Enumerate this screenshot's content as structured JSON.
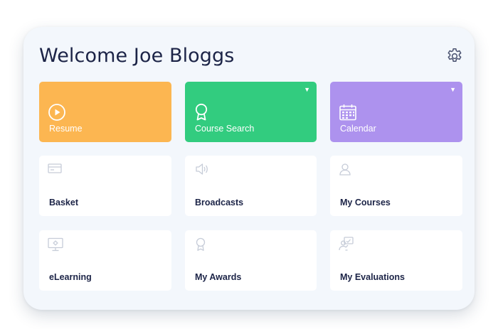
{
  "header": {
    "title": "Welcome Joe Bloggs"
  },
  "colors": {
    "resume": "#fcb651",
    "course_search": "#32cc7f",
    "calendar": "#ad92ee",
    "line_icon": "#c6ccd8"
  },
  "tiles": [
    {
      "label": "Resume",
      "icon": "play-icon"
    },
    {
      "label": "Course Search",
      "icon": "award-icon",
      "dropdown": "▼"
    },
    {
      "label": "Calendar",
      "icon": "calendar-icon",
      "dropdown": "▼"
    },
    {
      "label": "Basket",
      "icon": "card-icon"
    },
    {
      "label": "Broadcasts",
      "icon": "speaker-icon"
    },
    {
      "label": "My Courses",
      "icon": "user-icon"
    },
    {
      "label": "eLearning",
      "icon": "monitor-icon"
    },
    {
      "label": "My Awards",
      "icon": "award-icon"
    },
    {
      "label": "My Evaluations",
      "icon": "evaluation-icon"
    }
  ]
}
